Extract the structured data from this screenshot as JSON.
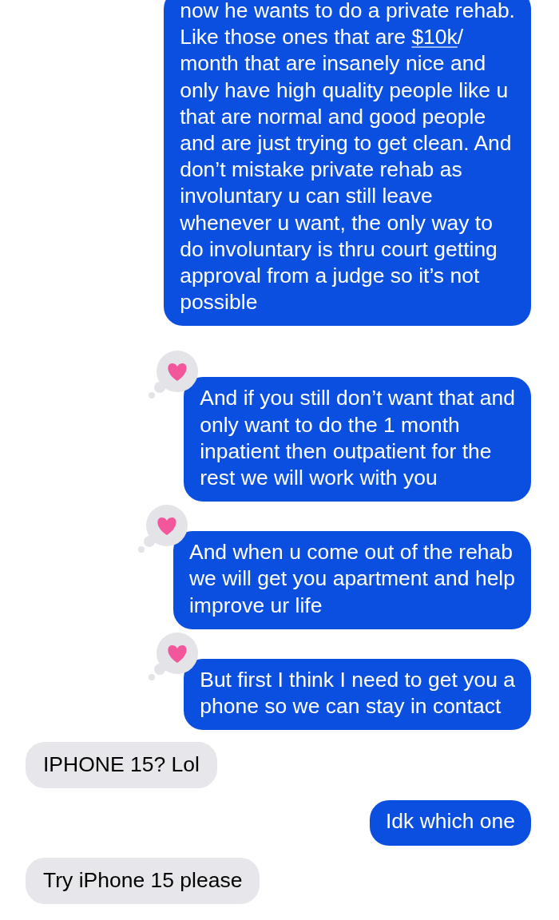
{
  "messages": [
    {
      "kind": "sent",
      "liked": false,
      "segments": [
        {
          "kind": "text",
          "text": "now he wants to do a private rehab.\nLike those ones that are "
        },
        {
          "kind": "link",
          "text": "$10k"
        },
        {
          "kind": "text",
          "text": "/\nmonth that are insanely nice and\nonly have high quality people like u\nthat are normal and good people\nand are just trying to get clean. And\ndon’t mistake private rehab as\ninvoluntary u can still leave\nwhenever u want, the only way to\ndo involuntary is thru court getting\napproval from a judge so it’s not\npossible"
        }
      ]
    },
    {
      "kind": "sent",
      "liked": true,
      "segments": [
        {
          "kind": "text",
          "text": "And if you still don’t want that and\nonly want to do the 1 month\ninpatient then outpatient for the\nrest we will work with you"
        }
      ]
    },
    {
      "kind": "sent",
      "liked": true,
      "segments": [
        {
          "kind": "text",
          "text": "And when u come out of the rehab\nwe will get you apartment and help\nimprove ur life"
        }
      ]
    },
    {
      "kind": "sent",
      "liked": true,
      "segments": [
        {
          "kind": "text",
          "text": "But first I think I need to get you a\nphone so we can stay in contact"
        }
      ]
    },
    {
      "kind": "received",
      "liked": false,
      "segments": [
        {
          "kind": "text",
          "text": "IPHONE 15? Lol"
        }
      ]
    },
    {
      "kind": "sent",
      "liked": false,
      "segments": [
        {
          "kind": "text",
          "text": "Idk which one"
        }
      ]
    },
    {
      "kind": "received",
      "liked": false,
      "segments": [
        {
          "kind": "text",
          "text": "Try iPhone 15 please"
        }
      ]
    }
  ]
}
